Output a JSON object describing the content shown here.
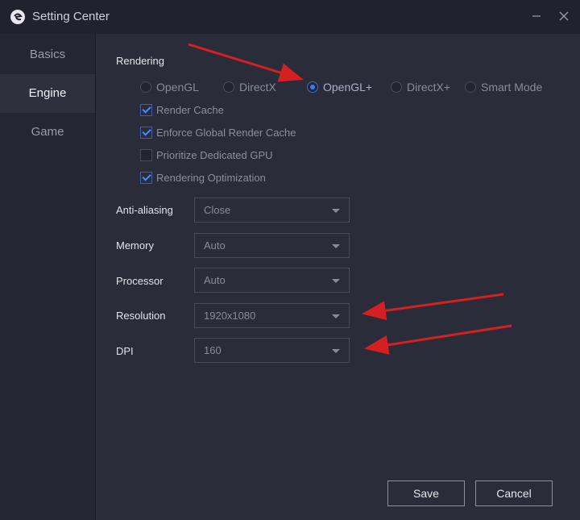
{
  "window": {
    "title": "Setting Center",
    "minimize_icon": "minimize-icon",
    "close_icon": "close-icon"
  },
  "sidebar": {
    "items": [
      {
        "label": "Basics",
        "active": false
      },
      {
        "label": "Engine",
        "active": true
      },
      {
        "label": "Game",
        "active": false
      }
    ]
  },
  "rendering": {
    "title": "Rendering",
    "modes": [
      {
        "label": "OpenGL",
        "selected": false
      },
      {
        "label": "DirectX",
        "selected": false
      },
      {
        "label": "OpenGL+",
        "selected": true
      },
      {
        "label": "DirectX+",
        "selected": false
      },
      {
        "label": "Smart Mode",
        "selected": false
      }
    ],
    "options": [
      {
        "label": "Render Cache",
        "checked": true
      },
      {
        "label": "Enforce Global Render Cache",
        "checked": true
      },
      {
        "label": "Prioritize Dedicated GPU",
        "checked": false
      },
      {
        "label": "Rendering Optimization",
        "checked": true
      }
    ]
  },
  "settings": [
    {
      "label": "Anti-aliasing",
      "value": "Close"
    },
    {
      "label": "Memory",
      "value": "Auto"
    },
    {
      "label": "Processor",
      "value": "Auto"
    },
    {
      "label": "Resolution",
      "value": "1920x1080"
    },
    {
      "label": "DPI",
      "value": "160"
    }
  ],
  "footer": {
    "save_label": "Save",
    "cancel_label": "Cancel"
  },
  "colors": {
    "accent": "#3b7cf0",
    "annotation_arrow": "#d42020",
    "background": "#2b2c3a"
  }
}
